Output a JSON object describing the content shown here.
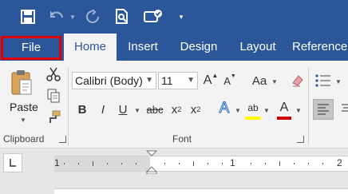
{
  "quick_access": {
    "items": [
      {
        "name": "save-icon"
      },
      {
        "name": "undo-icon"
      },
      {
        "name": "redo-icon"
      },
      {
        "name": "print-preview-icon"
      },
      {
        "name": "touch-mode-icon"
      },
      {
        "name": "customize-qat-icon"
      }
    ]
  },
  "tabs": {
    "file": "File",
    "home": "Home",
    "insert": "Insert",
    "design": "Design",
    "layout": "Layout",
    "references": "Reference"
  },
  "clipboard": {
    "paste_label": "Paste",
    "group_label": "Clipboard"
  },
  "font": {
    "family": "Calibri (Body)",
    "size": "11",
    "group_label": "Font",
    "buttons": {
      "bold": "B",
      "italic": "I",
      "underline": "U",
      "strikethrough": "abc",
      "subscript_base": "x",
      "subscript_mark": "2",
      "superscript_base": "x",
      "superscript_mark": "2",
      "grow": "A",
      "shrink": "A",
      "case": "Aa",
      "text_effects": "A",
      "highlight": "ab",
      "font_color": "A"
    }
  },
  "ruler": {
    "labels": [
      "1",
      "1",
      "2"
    ]
  },
  "colors": {
    "accent": "#2b579a",
    "highlight_red": "#e00000",
    "highlighter_yellow": "#ffff00",
    "font_color_red": "#d00000"
  }
}
